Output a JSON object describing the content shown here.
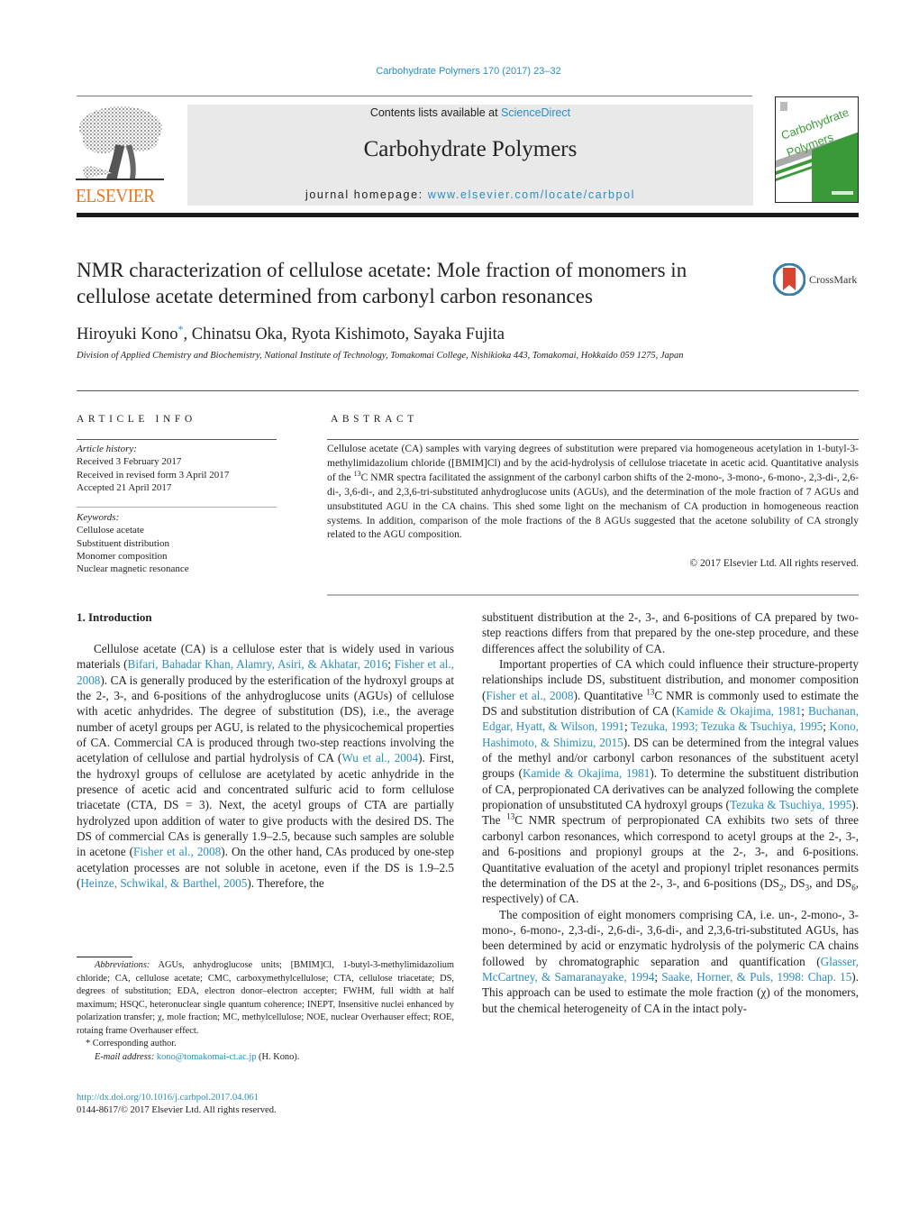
{
  "header": {
    "journal_reference": "Carbohydrate Polymers 170 (2017) 23–32",
    "contents_prefix": "Contents lists available at ",
    "contents_link": "ScienceDirect",
    "journal_title": "Carbohydrate Polymers",
    "homepage_prefix": "journal homepage: ",
    "homepage_link": "www.elsevier.com/locate/carbpol",
    "publisher_logo_text": "ELSEVIER",
    "cover": {
      "line1": "Carbohydrate",
      "line2": "Polymers"
    }
  },
  "article": {
    "title": "NMR characterization of cellulose acetate: Mole fraction of monomers in cellulose acetate determined from carbonyl carbon resonances",
    "crossmark_label": "CrossMark",
    "authors": [
      {
        "name": "Hiroyuki Kono",
        "mark": "*"
      },
      {
        "name": "Chinatsu Oka"
      },
      {
        "name": "Ryota Kishimoto"
      },
      {
        "name": "Sayaka Fujita"
      }
    ],
    "affiliation": "Division of Applied Chemistry and Biochemistry, National Institute of Technology, Tomakomai College, Nishikioka 443, Tomakomai, Hokkaido 059 1275, Japan"
  },
  "article_info": {
    "heading": "ARTICLE INFO",
    "history_label": "Article history:",
    "history": [
      "Received 3 February 2017",
      "Received in revised form 3 April 2017",
      "Accepted 21 April 2017"
    ],
    "keywords_label": "Keywords:",
    "keywords": [
      "Cellulose acetate",
      "Substituent distribution",
      "Monomer composition",
      "Nuclear magnetic resonance"
    ]
  },
  "abstract": {
    "heading": "ABSTRACT",
    "part1": "Cellulose acetate (CA) samples with varying degrees of substitution were prepared via homogeneous acetylation in 1-butyl-3-methylimidazolium chloride ([BMIM]Cl) and by the acid-hydrolysis of cellulose triacetate in acetic acid. Quantitative analysis of the ",
    "sup": "13",
    "part2": "C NMR spectra facilitated the assignment of the car­bonyl carbon shifts of the 2-mono-, 3-mono-, 6-mono-, 2,3-di-, 2,6-di-, 3,6-di-, and 2,3,6-tri-substituted anhydroglucose units (AGUs), and the determination of the mole fraction of 7 AGUs and unsubstituted AGU in the CA chains. This shed some light on the mechanism of CA production in homogeneous reaction systems. In addition, comparison of the mole fractions of the 8 AGUs suggested that the acetone solubility of CA strongly related to the AGU composition.",
    "copyright": "© 2017 Elsevier Ltd. All rights reserved."
  },
  "intro": {
    "heading": "1.  Introduction",
    "left": {
      "t1": "Cellulose acetate (CA) is a cellulose ester that is widely used in various materials (",
      "c1": "Bifari, Bahadar Khan, Alamry, Asiri, & Akhatar, 2016",
      "t2": "; ",
      "c2": "Fisher et al., 2008",
      "t3": "). CA is generally produced by the esterifi­cation of the hydroxyl groups at the 2-, 3-, and 6-positions of the anhydroglucose units (AGUs) of cellulose with acetic anhydrides. The degree of substitution (DS), i.e., the average number of acetyl groups per AGU, is related to the physicochemical properties of CA. Commercial CA is produced through two-step reactions involv­ing the acetylation of cellulose and partial hydrolysis of CA (",
      "c3": "Wu et al., 2004",
      "t4": "). First, the hydroxyl groups of cellulose are acetylated by acetic anhydride in the presence of acetic acid and concen­trated sulfuric acid to form cellulose triacetate (CTA, DS = 3). Next, the acetyl groups of CTA are partially hydrolyzed upon addition of water to give products with the desired DS. The DS of commer­cial CAs is generally 1.9–2.5, because such samples are soluble in acetone (",
      "c4": "Fisher et al., 2008",
      "t5": "). On the other hand, CAs produced by one-step acetylation processes are not soluble in acetone, even if the DS is 1.9–2.5 (",
      "c5": "Heinze, Schwikal, & Barthel, 2005",
      "t6": "). Therefore, the"
    },
    "right": {
      "p1": "substituent distribution at the 2-, 3-, and 6-positions of CA prepared by two-step reactions differs from that prepared by the one-step procedure, and these differences affect the solubility of CA.",
      "p2_t1": "Important properties of CA which could influence their structure-property relationships include DS, substituent distribu­tion, and monomer composition (",
      "p2_c1": "Fisher et al., 2008",
      "p2_t2": "). Quantitative ",
      "p2_sup1": "13",
      "p2_t3": "C NMR is commonly used to estimate the DS and substitution dis­tribution of CA (",
      "p2_c2": "Kamide & Okajima, 1981",
      "p2_t4": "; ",
      "p2_c3": "Buchanan, Edgar, Hyatt, & Wilson, 1991",
      "p2_t5": "; ",
      "p2_c4": "Tezuka, 1993; Tezuka & Tsuchiya, 1995",
      "p2_t6": "; ",
      "p2_c5": "Kono, Hashimoto, & Shimizu, 2015",
      "p2_t7": "). DS can be determined from the inte­gral values of the methyl and/or carbonyl carbon resonances of the substituent acetyl groups (",
      "p2_c6": "Kamide & Okajima, 1981",
      "p2_t8": "). To determine the substituent distribution of CA, perpropionated CA derivatives can be analyzed following the complete propionation of unsub­stituted CA hydroxyl groups (",
      "p2_c7": "Tezuka & Tsuchiya, 1995",
      "p2_t9": "). The ",
      "p2_sup2": "13",
      "p2_t10": "C NMR spectrum of perpropionated CA exhibits two sets of three carbonyl carbon resonances, which correspond to acetyl groups at the 2-, 3-, and 6-positions and propionyl groups at the 2-, 3-, and 6-positions. Quantitative evaluation of the acetyl and propi­onyl triplet resonances permits the determination of the DS at the 2-, 3-, and 6-positions (DS",
      "p2_sub1": "2",
      "p2_t11": ", DS",
      "p2_sub2": "3",
      "p2_t12": ", and DS",
      "p2_sub3": "6",
      "p2_t13": ", respectively) of CA.",
      "p3_t1": "The composition of eight monomers comprising CA, i.e. un-, 2-mono-, 3-mono-, 6-mono-, 2,3-di-, 2,6-di-, 3,6-di-, and 2,3,6-tri-substituted AGUs, has been determined by acid or enzymatic hydrolysis of the polymeric CA chains followed by chromato­graphic separation and quantification (",
      "p3_c1": "Glasser, McCartney, & Samaranayake, 1994",
      "p3_t2": "; ",
      "p3_c2": "Saake, Horner, & Puls, 1998: Chap. 15",
      "p3_t3": "). This approach can be used to estimate the mole fraction (χ) of the monomers, but the chemical heterogeneity of CA in the intact poly-"
    }
  },
  "footnotes": {
    "abbrev_label": "Abbreviations:",
    "abbrev_text": " AGUs, anhydroglucose units; [BMIM]Cl, 1-butyl-3-methylimidazolium chloride; CA, cellulose acetate; CMC, carboxymethylcellulose; CTA, cellulose triacetate; DS, degrees of substitution; EDA, electron donor–electron accepter; FWHM, full width at half maximum; HSQC, heteronuclear single quantum coherence; INEPT, Insensitive nuclei enhanced by polarization transfer; χ, mole fraction; MC, methylcellulose; NOE, nuclear Overhauser effect; ROE, rotaing frame Overhauser effect.",
    "corresponding": "*  Corresponding author.",
    "email_label": "E-mail address: ",
    "email": "kono@tomakomai-ct.ac.jp",
    "email_suffix": " (H. Kono)."
  },
  "doi": {
    "link": "http://dx.doi.org/10.1016/j.carbpol.2017.04.061",
    "issn_line": "0144-8617/© 2017 Elsevier Ltd. All rights reserved."
  },
  "colors": {
    "link": "#2a8fc1",
    "elsevier_orange": "#e87722",
    "cover_green": "#3a9a3a",
    "crossmark_red": "#d9432f",
    "masthead_gray": "#e9e9e9"
  }
}
